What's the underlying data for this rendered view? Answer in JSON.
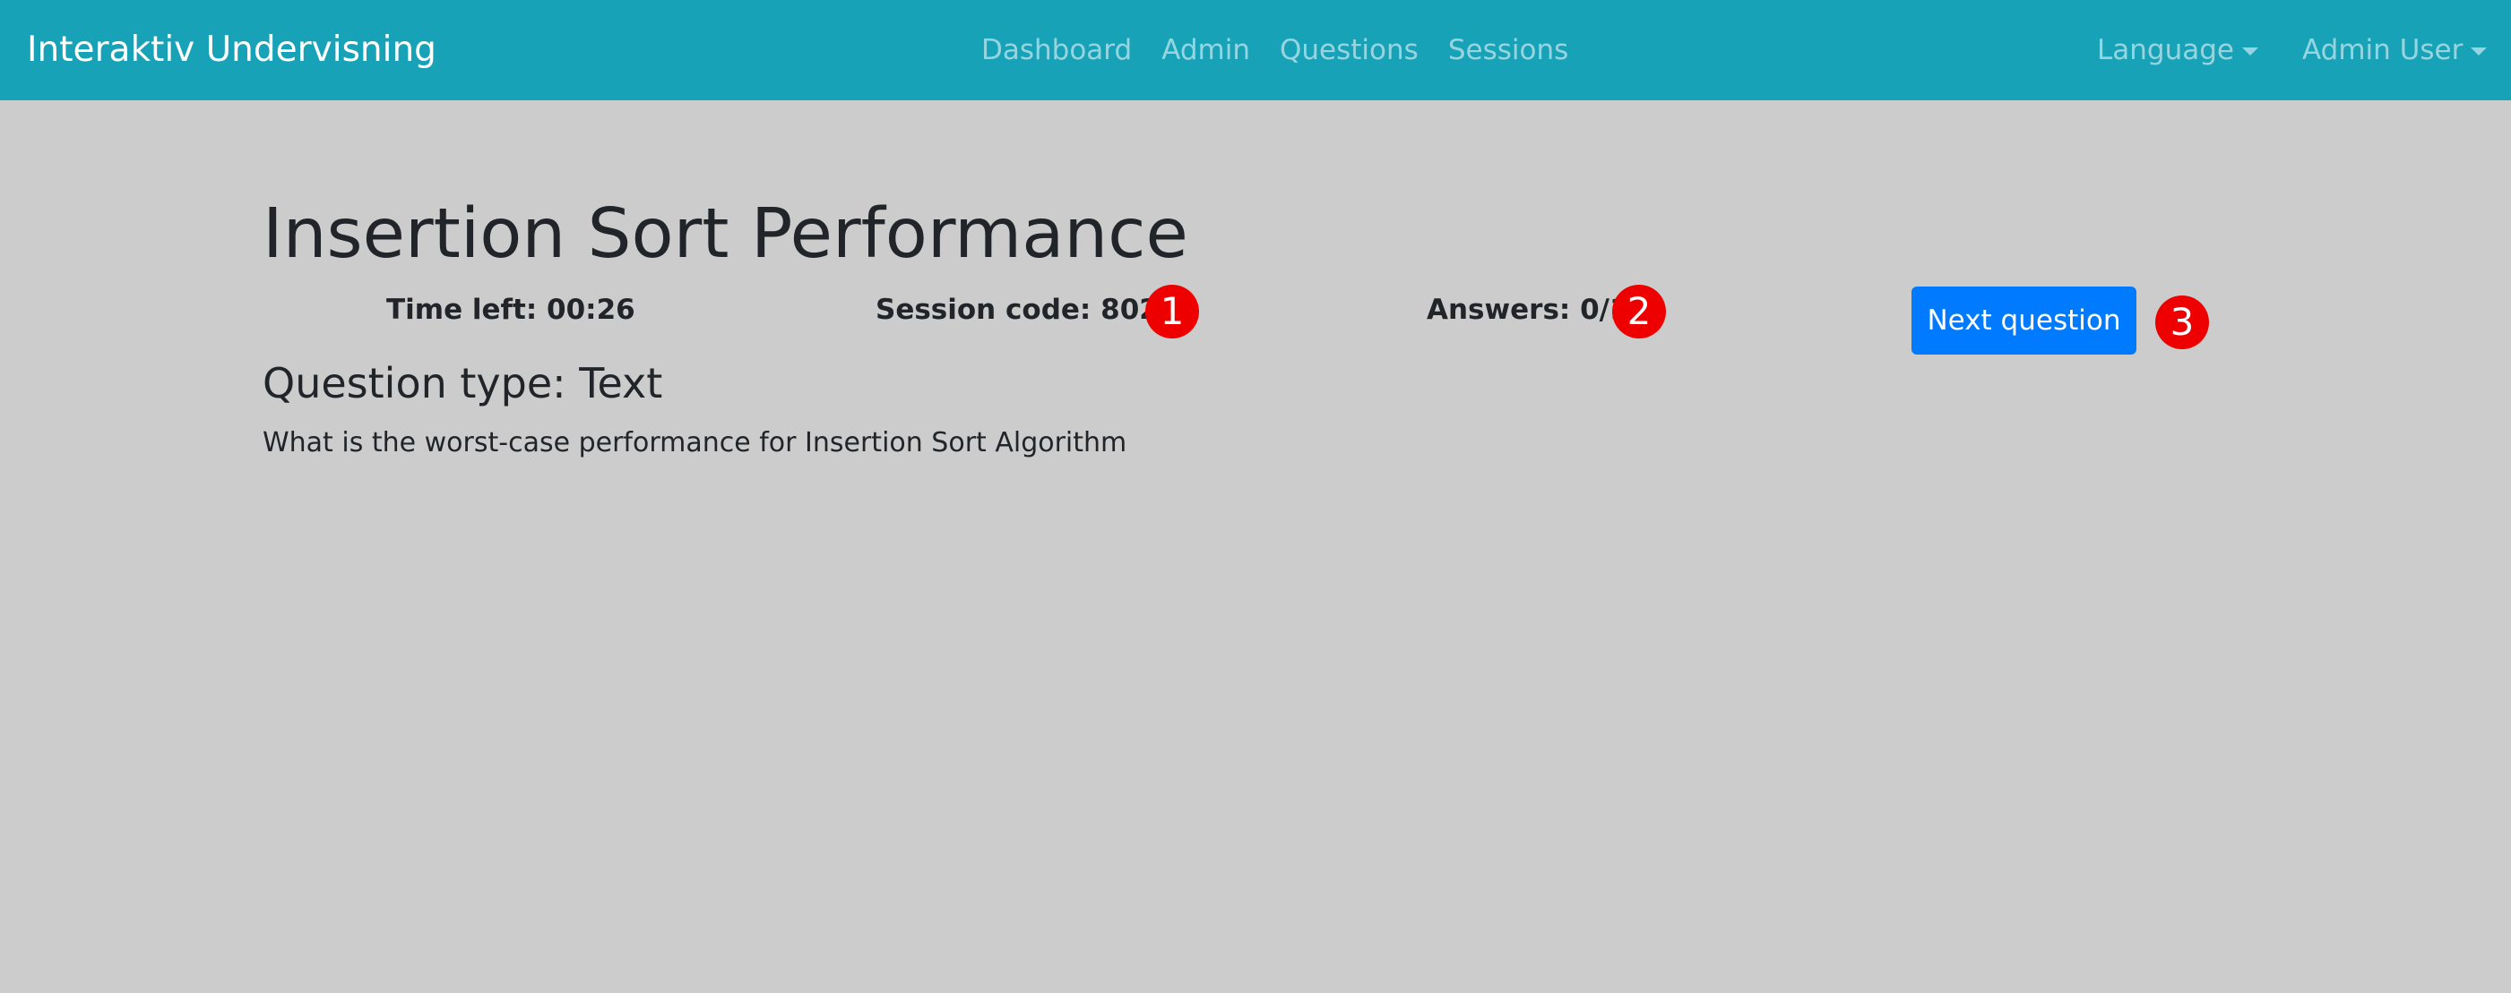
{
  "navbar": {
    "brand": "Interaktiv Undervisning",
    "links": [
      "Dashboard",
      "Admin",
      "Questions",
      "Sessions"
    ],
    "language": "Language",
    "user": "Admin User",
    "background": "#17a2b8"
  },
  "session": {
    "title": "Insertion Sort Performance",
    "time_left": "Time left: 00:26",
    "session_code": "Session code: 8028",
    "answers": "Answers: 0/1",
    "next_button": "Next question"
  },
  "question": {
    "type": "Question type: Text",
    "text": "What is the worst-case performance for Insertion Sort Algorithm"
  },
  "markers": [
    "1",
    "2",
    "3"
  ],
  "colors": {
    "page_background": "#cccccc",
    "primary_button": "#007bff",
    "marker": "#ee0000"
  }
}
